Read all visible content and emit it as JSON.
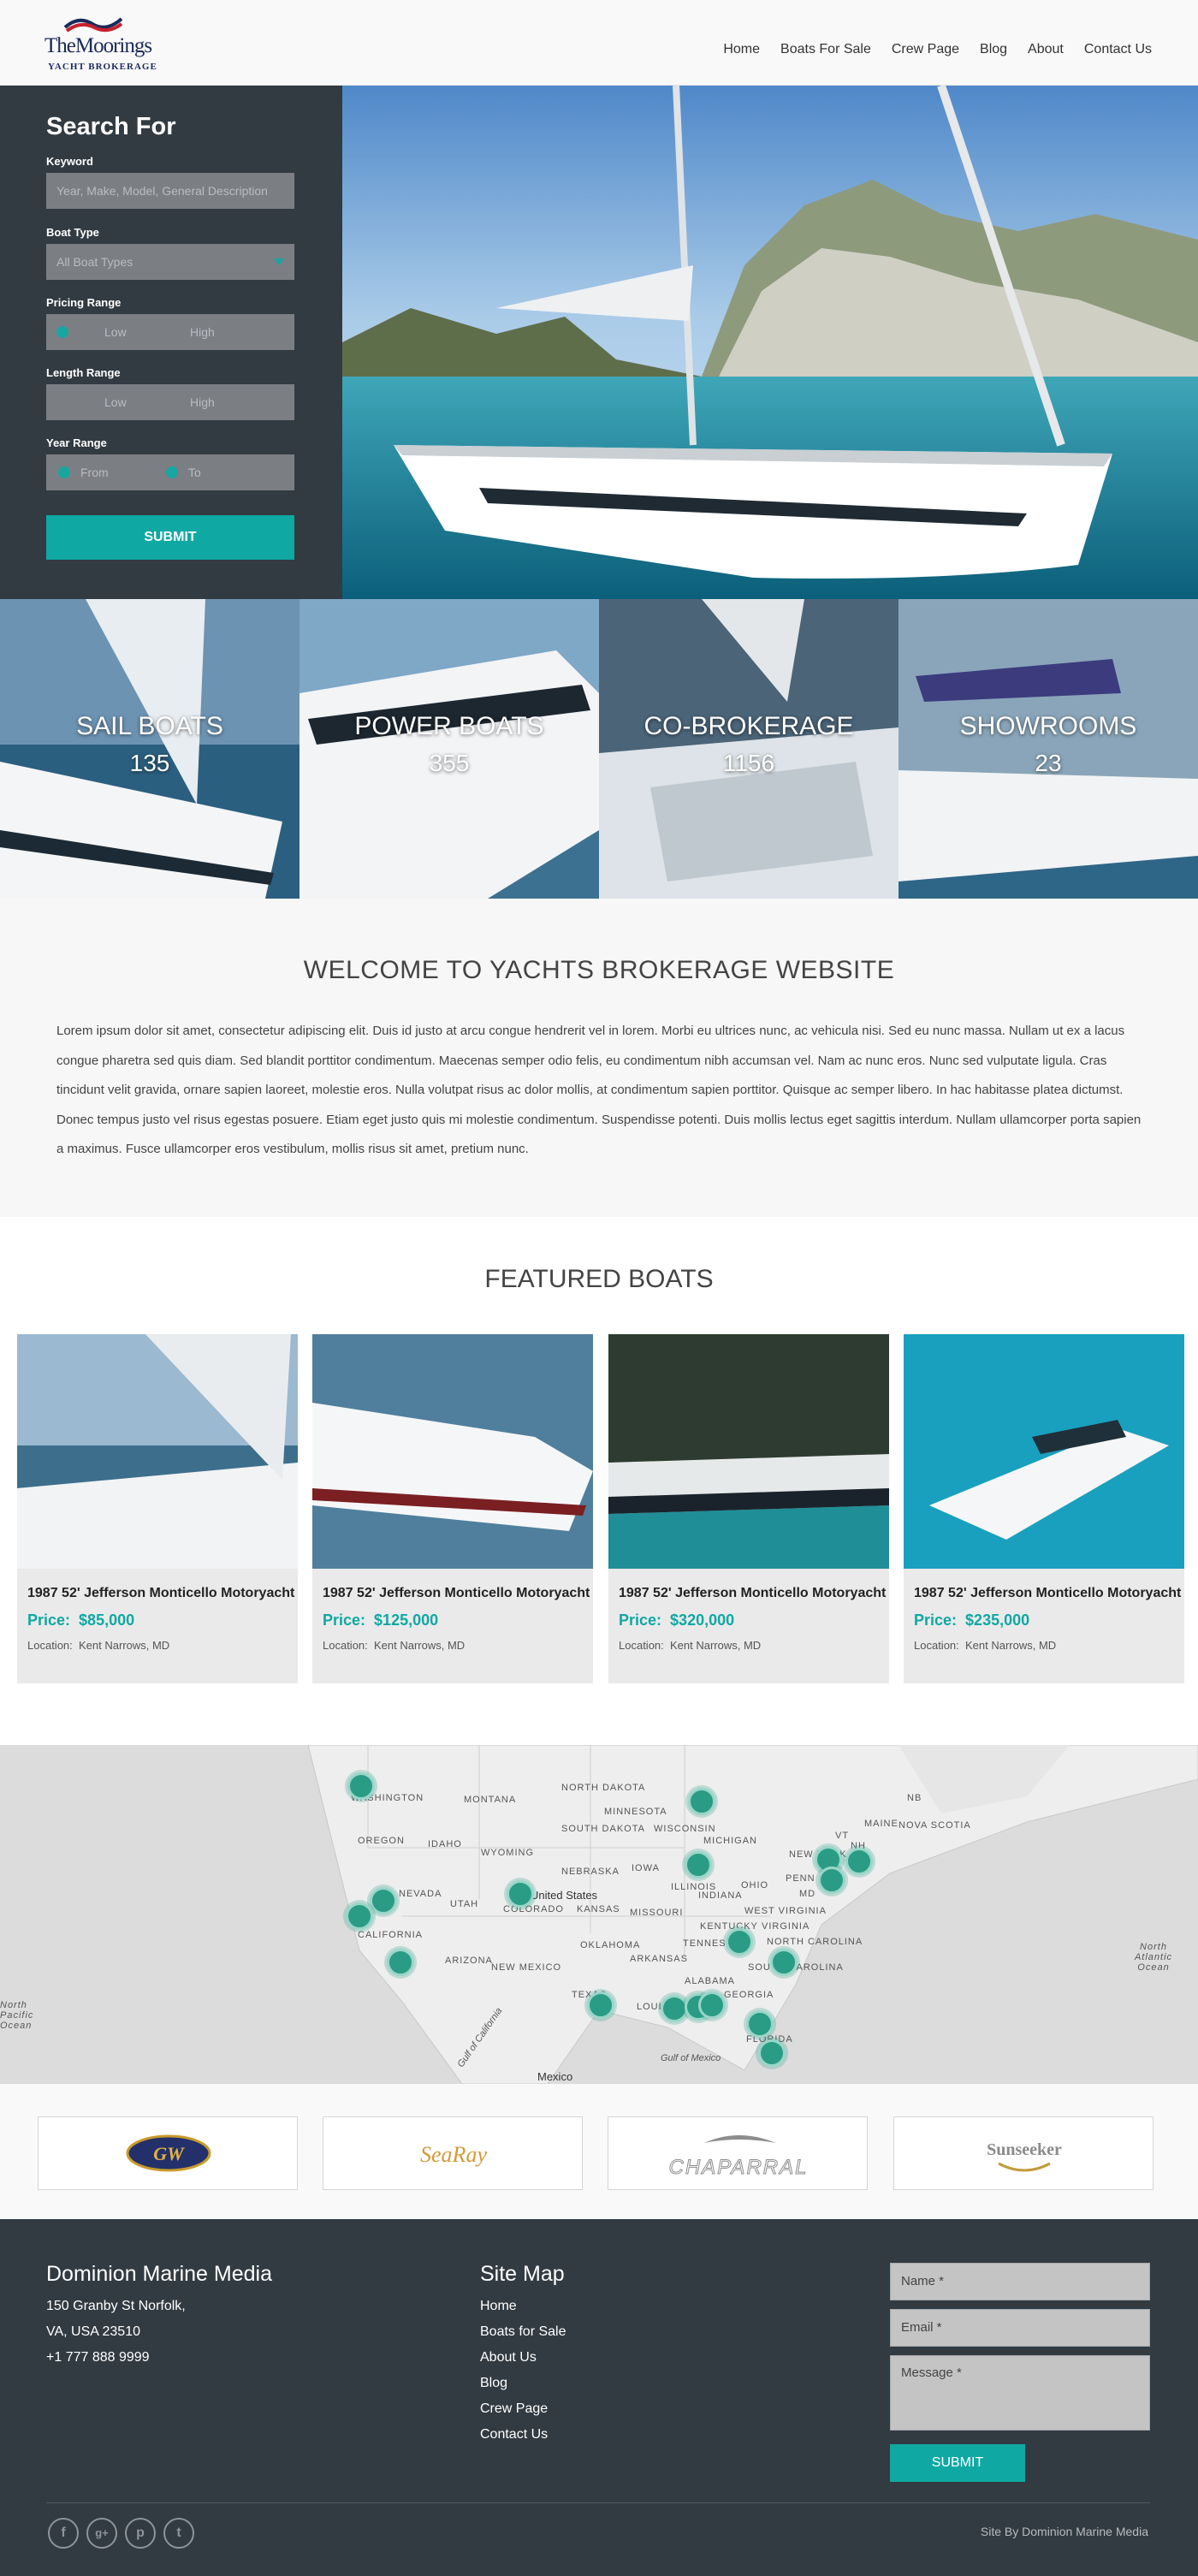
{
  "header": {
    "logo_name": "TheMoorings",
    "logo_sub": "YACHT BROKERAGE",
    "nav": [
      "Home",
      "Boats For Sale",
      "Crew Page",
      "Blog",
      "About",
      "Contact Us"
    ]
  },
  "search": {
    "title": "Search For",
    "keyword_label": "Keyword",
    "keyword_placeholder": "Year, Make, Model, General Description",
    "boat_type_label": "Boat Type",
    "boat_type_value": "All Boat Types",
    "pricing_label": "Pricing Range",
    "pricing_low": "Low",
    "pricing_high": "High",
    "length_label": "Length Range",
    "length_low": "Low",
    "length_high": "High",
    "year_label": "Year Range",
    "year_from": "From",
    "year_to": "To",
    "submit": "SUBMIT"
  },
  "categories": [
    {
      "title": "SAIL BOATS",
      "count": "135"
    },
    {
      "title": "POWER BOATS",
      "count": "355"
    },
    {
      "title": "CO-BROKERAGE",
      "count": "1156"
    },
    {
      "title": "SHOWROOMS",
      "count": "23"
    }
  ],
  "welcome": {
    "title": "WELCOME TO YACHTS BROKERAGE WEBSITE",
    "body": "Lorem ipsum dolor sit amet, consectetur adipiscing elit. Duis id justo at arcu congue hendrerit vel in lorem. Morbi eu ultrices nunc, ac vehicula nisi. Sed eu nunc massa. Nullam ut ex a lacus congue pharetra sed quis diam. Sed blandit porttitor condimentum. Maecenas semper odio felis, eu condimentum nibh accumsan vel. Nam ac nunc eros. Nunc sed vulputate ligula. Cras tincidunt velit gravida, ornare sapien laoreet, molestie eros. Nulla volutpat risus ac dolor mollis, at condimentum sapien porttitor. Quisque ac semper libero. In hac habitasse platea dictumst. Donec tempus justo vel risus egestas posuere. Etiam eget justo quis mi molestie condimentum. Suspendisse potenti. Duis mollis lectus eget sagittis interdum. Nullam ullamcorper porta sapien a maximus. Fusce ullamcorper eros vestibulum, mollis risus sit amet, pretium nunc."
  },
  "featured": {
    "title": "FEATURED BOATS",
    "price_label": "Price:",
    "location_label": "Location:",
    "boats": [
      {
        "title": "1987 52' Jefferson Monticello Motoryacht",
        "price": "$85,000",
        "location": "Kent Narrows, MD"
      },
      {
        "title": "1987 52' Jefferson Monticello Motoryacht",
        "price": "$125,000",
        "location": "Kent Narrows, MD"
      },
      {
        "title": "1987 52' Jefferson Monticello Motoryacht",
        "price": "$320,000",
        "location": "Kent Narrows, MD"
      },
      {
        "title": "1987 52' Jefferson Monticello Motoryacht",
        "price": "$235,000",
        "location": "Kent Narrows, MD"
      }
    ]
  },
  "map": {
    "labels": [
      "WASHINGTON",
      "MONTANA",
      "NORTH DAKOTA",
      "MINNESOTA",
      "OREGON",
      "IDAHO",
      "WYOMING",
      "SOUTH DAKOTA",
      "WISCONSIN",
      "MICHIGAN",
      "NEBRASKA",
      "IOWA",
      "NEVADA",
      "UTAH",
      "United States",
      "KANSAS",
      "MISSOURI",
      "ILLINOIS",
      "INDIANA",
      "OHIO",
      "PENN",
      "NEW YORK",
      "MAINE",
      "NOVA SCOTIA",
      "CALIFORNIA",
      "COLORADO",
      "OKLAHOMA",
      "ARKANSAS",
      "TENNESSEE",
      "KENTUCKY",
      "WEST VIRGINIA",
      "VIRGINIA",
      "NORTH CAROLINA",
      "ARIZONA",
      "NEW MEXICO",
      "TEXAS",
      "LOUISIANA",
      "ALABAMA",
      "GEORGIA",
      "SOUTH CAROLINA",
      "FLORIDA",
      "Gulf of Mexico",
      "Mexico",
      "Gulf of California",
      "North Atlantic Ocean",
      "North Pacific Ocean",
      "NB",
      "VT",
      "NH",
      "MA",
      "NJ",
      "MD"
    ]
  },
  "brands": [
    "GW",
    "SeaRay",
    "CHAPARRAL",
    "Sunseeker"
  ],
  "footer": {
    "company": "Dominion Marine Media",
    "address1": "150 Granby St Norfolk,",
    "address2": "VA, USA 23510",
    "phone": "+1 777 888 9999",
    "sitemap_title": "Site Map",
    "sitemap": [
      "Home",
      "Boats for Sale",
      "About Us",
      "Blog",
      "Crew Page",
      "Contact Us"
    ],
    "name_ph": "Name *",
    "email_ph": "Email *",
    "message_ph": "Message *",
    "submit": "SUBMIT",
    "social": [
      "f",
      "g+",
      "p",
      "t"
    ],
    "credit": "Site By Dominion Marine Media"
  },
  "colors": {
    "accent": "#0fa8a3",
    "panel": "#323b42",
    "pin": "#2a9c86"
  }
}
